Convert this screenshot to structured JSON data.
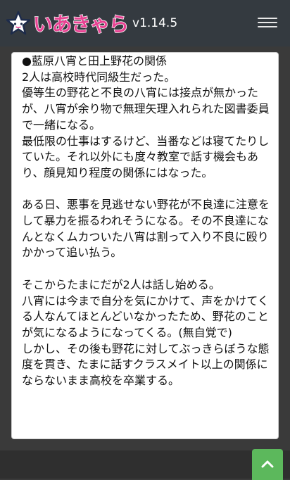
{
  "header": {
    "logo_text": "いあきゃら",
    "version": "v1.14.5",
    "star_icon": "star-logo-icon",
    "menu_icon": "hamburger-icon"
  },
  "article": {
    "paragraphs": [
      "●藍原八宵と田上野花の関係\n2人は高校時代同級生だった。\n優等生の野花と不良の八宵には接点が無かったが、八宵が余り物で無理矢理入れられた図書委員で一緒になる。\n最低限の仕事はするけど、当番などは寝てたりしていた。それ以外にも度々教室で話す機会もあり、顔見知り程度の関係にはなった。",
      "ある日、悪事を見逃せない野花が不良達に注意をして暴力を振るわれそうになる。その不良達になんとなくムカついた八宵は割って入り不良に殴りかかって追い払う。",
      "そこからたまにだが2人は話し始める。\n八宵には今まで自分を気にかけて、声をかけてくる人なんてほとんどいなかったため、野花のことが気になるようになってくる。(無自覚で)\nしかし、その後も野花に対してぶっきらぼうな態度を貫き、たまに話すクラスメイト以上の関係にならないまま高校を卒業する。"
    ]
  },
  "scroll_top": {
    "icon": "chevron-up-icon",
    "color": "#5cb85c"
  },
  "colors": {
    "navbar": "#343a40",
    "logo": "#e84393",
    "background": "#3a3a3a"
  }
}
